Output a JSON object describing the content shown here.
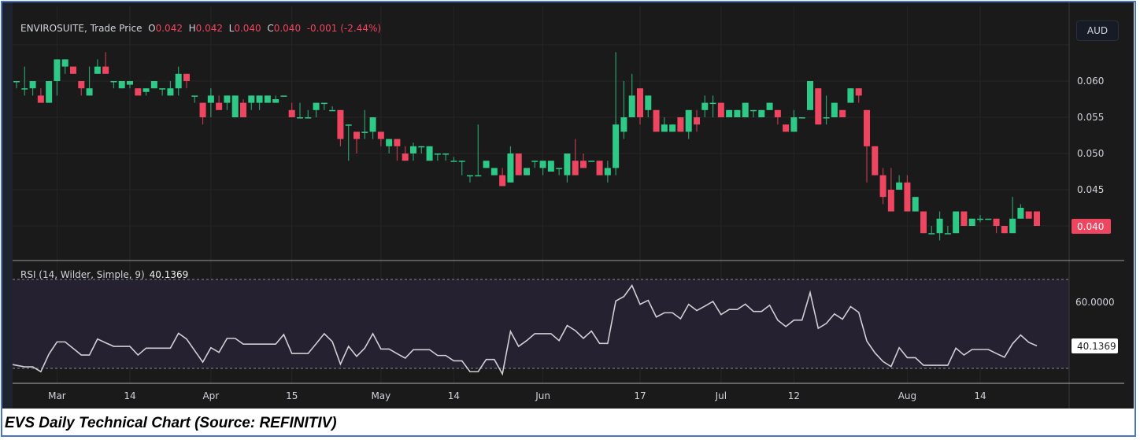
{
  "legend": {
    "symbol": "ENVIROSUITE, Trade Price",
    "o_label": "O",
    "o_value": "0.042",
    "h_label": "H",
    "h_value": "0.042",
    "l_label": "L",
    "l_value": "0.040",
    "c_label": "C",
    "c_value": "0.040",
    "change": "-0.001 (-2.44%)"
  },
  "currency_button": "AUD",
  "rsi_legend": {
    "label": "RSI (14, Wilder, Simple, 9)",
    "value": "40.1369"
  },
  "caption": "EVS Daily Technical Chart (Source: REFINITIV)",
  "colors": {
    "up": "#2ec986",
    "down": "#ee4560",
    "rsi_line": "#d0d0d4",
    "rsi_band": "#262131"
  },
  "chart_data": [
    {
      "type": "candlestick",
      "title": "ENVIROSUITE, Trade Price",
      "ylabel": "AUD",
      "ylim": [
        0.0355,
        0.0665
      ],
      "y_ticks": [
        "0.060",
        "0.055",
        "0.050",
        "0.045"
      ],
      "last_price_label": "0.040",
      "x_ticks": [
        "Mar",
        "14",
        "Apr",
        "15",
        "May",
        "14",
        "Jun",
        "17",
        "Jul",
        "12",
        "Aug",
        "14"
      ],
      "x_tick_index": [
        5,
        14,
        24,
        34,
        45,
        54,
        65,
        77,
        87,
        96,
        110,
        119
      ],
      "ohlc": [
        [
          0.06,
          0.06,
          0.059,
          0.06
        ],
        [
          0.059,
          0.062,
          0.058,
          0.059
        ],
        [
          0.059,
          0.06,
          0.058,
          0.06
        ],
        [
          0.058,
          0.059,
          0.057,
          0.057
        ],
        [
          0.057,
          0.06,
          0.057,
          0.06
        ],
        [
          0.06,
          0.063,
          0.058,
          0.063
        ],
        [
          0.062,
          0.063,
          0.061,
          0.063
        ],
        [
          0.062,
          0.062,
          0.061,
          0.061
        ],
        [
          0.06,
          0.06,
          0.058,
          0.059
        ],
        [
          0.058,
          0.062,
          0.058,
          0.059
        ],
        [
          0.061,
          0.063,
          0.061,
          0.062
        ],
        [
          0.062,
          0.064,
          0.061,
          0.061
        ],
        [
          0.06,
          0.06,
          0.059,
          0.06
        ],
        [
          0.059,
          0.06,
          0.059,
          0.06
        ],
        [
          0.0595,
          0.06,
          0.059,
          0.06
        ],
        [
          0.059,
          0.059,
          0.058,
          0.058
        ],
        [
          0.0585,
          0.059,
          0.058,
          0.059
        ],
        [
          0.059,
          0.06,
          0.059,
          0.06
        ],
        [
          0.059,
          0.059,
          0.058,
          0.059
        ],
        [
          0.058,
          0.06,
          0.058,
          0.059
        ],
        [
          0.059,
          0.062,
          0.058,
          0.061
        ],
        [
          0.061,
          0.061,
          0.059,
          0.06
        ],
        [
          0.058,
          0.058,
          0.057,
          0.058
        ],
        [
          0.057,
          0.057,
          0.054,
          0.055
        ],
        [
          0.057,
          0.059,
          0.055,
          0.058
        ],
        [
          0.057,
          0.058,
          0.056,
          0.056
        ],
        [
          0.057,
          0.058,
          0.056,
          0.058
        ],
        [
          0.055,
          0.058,
          0.055,
          0.058
        ],
        [
          0.057,
          0.0575,
          0.055,
          0.055
        ],
        [
          0.057,
          0.058,
          0.056,
          0.058
        ],
        [
          0.057,
          0.058,
          0.056,
          0.058
        ],
        [
          0.057,
          0.058,
          0.057,
          0.058
        ],
        [
          0.057,
          0.058,
          0.057,
          0.0575
        ],
        [
          0.058,
          0.058,
          0.058,
          0.058
        ],
        [
          0.056,
          0.057,
          0.055,
          0.055
        ],
        [
          0.055,
          0.057,
          0.055,
          0.055
        ],
        [
          0.055,
          0.056,
          0.055,
          0.055
        ],
        [
          0.056,
          0.057,
          0.055,
          0.057
        ],
        [
          0.057,
          0.057,
          0.056,
          0.057
        ],
        [
          0.056,
          0.0565,
          0.056,
          0.056
        ],
        [
          0.056,
          0.056,
          0.051,
          0.052
        ],
        [
          0.054,
          0.054,
          0.049,
          0.054
        ],
        [
          0.053,
          0.053,
          0.05,
          0.052
        ],
        [
          0.053,
          0.056,
          0.052,
          0.053
        ],
        [
          0.053,
          0.055,
          0.052,
          0.055
        ],
        [
          0.053,
          0.053,
          0.051,
          0.052
        ],
        [
          0.051,
          0.052,
          0.05,
          0.052
        ],
        [
          0.052,
          0.052,
          0.049,
          0.051
        ],
        [
          0.05,
          0.051,
          0.049,
          0.049
        ],
        [
          0.05,
          0.0515,
          0.049,
          0.051
        ],
        [
          0.051,
          0.051,
          0.05,
          0.051
        ],
        [
          0.049,
          0.051,
          0.049,
          0.051
        ],
        [
          0.05,
          0.05,
          0.049,
          0.05
        ],
        [
          0.05,
          0.05,
          0.049,
          0.05
        ],
        [
          0.049,
          0.0495,
          0.049,
          0.049
        ],
        [
          0.049,
          0.049,
          0.047,
          0.049
        ],
        [
          0.047,
          0.047,
          0.046,
          0.047
        ],
        [
          0.047,
          0.054,
          0.047,
          0.047
        ],
        [
          0.048,
          0.049,
          0.048,
          0.049
        ],
        [
          0.047,
          0.048,
          0.047,
          0.048
        ],
        [
          0.047,
          0.048,
          0.0455,
          0.0455
        ],
        [
          0.046,
          0.051,
          0.046,
          0.05
        ],
        [
          0.05,
          0.05,
          0.047,
          0.047
        ],
        [
          0.047,
          0.048,
          0.047,
          0.048
        ],
        [
          0.049,
          0.049,
          0.048,
          0.049
        ],
        [
          0.048,
          0.049,
          0.047,
          0.049
        ],
        [
          0.0475,
          0.049,
          0.0475,
          0.049
        ],
        [
          0.048,
          0.048,
          0.047,
          0.048
        ],
        [
          0.047,
          0.05,
          0.046,
          0.05
        ],
        [
          0.049,
          0.052,
          0.047,
          0.047
        ],
        [
          0.049,
          0.05,
          0.048,
          0.048
        ],
        [
          0.049,
          0.049,
          0.049,
          0.049
        ],
        [
          0.049,
          0.049,
          0.047,
          0.047
        ],
        [
          0.047,
          0.049,
          0.046,
          0.048
        ],
        [
          0.048,
          0.064,
          0.047,
          0.054
        ],
        [
          0.053,
          0.06,
          0.052,
          0.055
        ],
        [
          0.055,
          0.061,
          0.055,
          0.058
        ],
        [
          0.059,
          0.059,
          0.054,
          0.055
        ],
        [
          0.056,
          0.058,
          0.055,
          0.058
        ],
        [
          0.056,
          0.056,
          0.053,
          0.053
        ],
        [
          0.053,
          0.055,
          0.053,
          0.054
        ],
        [
          0.053,
          0.054,
          0.053,
          0.054
        ],
        [
          0.055,
          0.055,
          0.053,
          0.053
        ],
        [
          0.053,
          0.056,
          0.052,
          0.056
        ],
        [
          0.055,
          0.056,
          0.053,
          0.054
        ],
        [
          0.056,
          0.058,
          0.055,
          0.057
        ],
        [
          0.057,
          0.058,
          0.055,
          0.057
        ],
        [
          0.057,
          0.057,
          0.055,
          0.055
        ],
        [
          0.055,
          0.056,
          0.055,
          0.056
        ],
        [
          0.055,
          0.056,
          0.055,
          0.056
        ],
        [
          0.055,
          0.057,
          0.055,
          0.057
        ],
        [
          0.056,
          0.056,
          0.055,
          0.056
        ],
        [
          0.055,
          0.056,
          0.055,
          0.056
        ],
        [
          0.056,
          0.057,
          0.056,
          0.057
        ],
        [
          0.056,
          0.056,
          0.054,
          0.055
        ],
        [
          0.054,
          0.054,
          0.053,
          0.053
        ],
        [
          0.053,
          0.056,
          0.053,
          0.055
        ],
        [
          0.055,
          0.055,
          0.055,
          0.055
        ],
        [
          0.056,
          0.06,
          0.056,
          0.06
        ],
        [
          0.059,
          0.059,
          0.054,
          0.054
        ],
        [
          0.055,
          0.058,
          0.054,
          0.055
        ],
        [
          0.055,
          0.057,
          0.055,
          0.057
        ],
        [
          0.056,
          0.056,
          0.055,
          0.055
        ],
        [
          0.057,
          0.059,
          0.057,
          0.059
        ],
        [
          0.059,
          0.059,
          0.057,
          0.058
        ],
        [
          0.056,
          0.056,
          0.046,
          0.051
        ],
        [
          0.051,
          0.051,
          0.047,
          0.047
        ],
        [
          0.047,
          0.048,
          0.043,
          0.044
        ],
        [
          0.045,
          0.048,
          0.042,
          0.042
        ],
        [
          0.045,
          0.047,
          0.045,
          0.046
        ],
        [
          0.046,
          0.047,
          0.042,
          0.042
        ],
        [
          0.042,
          0.044,
          0.042,
          0.044
        ],
        [
          0.042,
          0.042,
          0.039,
          0.039
        ],
        [
          0.039,
          0.04,
          0.039,
          0.039
        ],
        [
          0.039,
          0.042,
          0.038,
          0.041
        ],
        [
          0.039,
          0.04,
          0.039,
          0.039
        ],
        [
          0.039,
          0.042,
          0.039,
          0.042
        ],
        [
          0.042,
          0.042,
          0.04,
          0.04
        ],
        [
          0.04,
          0.041,
          0.04,
          0.041
        ],
        [
          0.041,
          0.0415,
          0.0405,
          0.041
        ],
        [
          0.041,
          0.041,
          0.041,
          0.041
        ],
        [
          0.041,
          0.041,
          0.039,
          0.04
        ],
        [
          0.04,
          0.04,
          0.039,
          0.039
        ],
        [
          0.039,
          0.044,
          0.039,
          0.041
        ],
        [
          0.041,
          0.043,
          0.041,
          0.0425
        ],
        [
          0.042,
          0.042,
          0.041,
          0.041
        ],
        [
          0.042,
          0.042,
          0.04,
          0.04
        ]
      ]
    },
    {
      "type": "line",
      "title": "RSI (14, Wilder, Simple, 9)",
      "ylim": [
        24,
        80
      ],
      "bands": [
        30,
        70
      ],
      "y_ticks": [
        "60.0000"
      ],
      "last_value_label": "40.1369",
      "values": [
        31.7,
        30.7,
        30.7,
        28.5,
        36.4,
        41.9,
        41.9,
        39.0,
        36.0,
        36.0,
        43.2,
        41.5,
        39.9,
        39.9,
        39.9,
        36.0,
        39.1,
        39.1,
        39.1,
        39.1,
        45.8,
        43.2,
        38.0,
        32.8,
        39.3,
        37.2,
        43.5,
        43.5,
        40.9,
        40.9,
        40.9,
        40.9,
        40.9,
        45.2,
        36.7,
        36.7,
        36.7,
        41.1,
        45.6,
        42.0,
        31.9,
        39.9,
        35.4,
        39.1,
        45.6,
        38.7,
        38.7,
        36.6,
        34.6,
        38.4,
        38.4,
        38.4,
        35.8,
        35.8,
        33.4,
        33.4,
        28.5,
        28.5,
        34.0,
        34.0,
        27.5,
        46.6,
        39.9,
        42.5,
        45.6,
        45.6,
        45.6,
        42.5,
        49.3,
        47.0,
        43.5,
        46.8,
        41.2,
        41.2,
        60.3,
        62.3,
        67.3,
        58.8,
        60.6,
        53.1,
        55.0,
        55.0,
        52.3,
        58.8,
        56.0,
        58.0,
        60.1,
        54.2,
        56.5,
        56.5,
        58.9,
        55.6,
        55.6,
        58.4,
        51.7,
        48.8,
        51.7,
        51.7,
        64.1,
        48.0,
        50.2,
        54.5,
        52.1,
        57.8,
        55.2,
        42.3,
        37.0,
        33.1,
        30.8,
        39.3,
        34.8,
        34.8,
        31.4,
        31.4,
        31.4,
        31.4,
        39.1,
        36.0,
        38.5,
        38.5,
        38.5,
        36.7,
        35.0,
        41.1,
        45.0,
        41.7,
        40.14
      ]
    }
  ]
}
